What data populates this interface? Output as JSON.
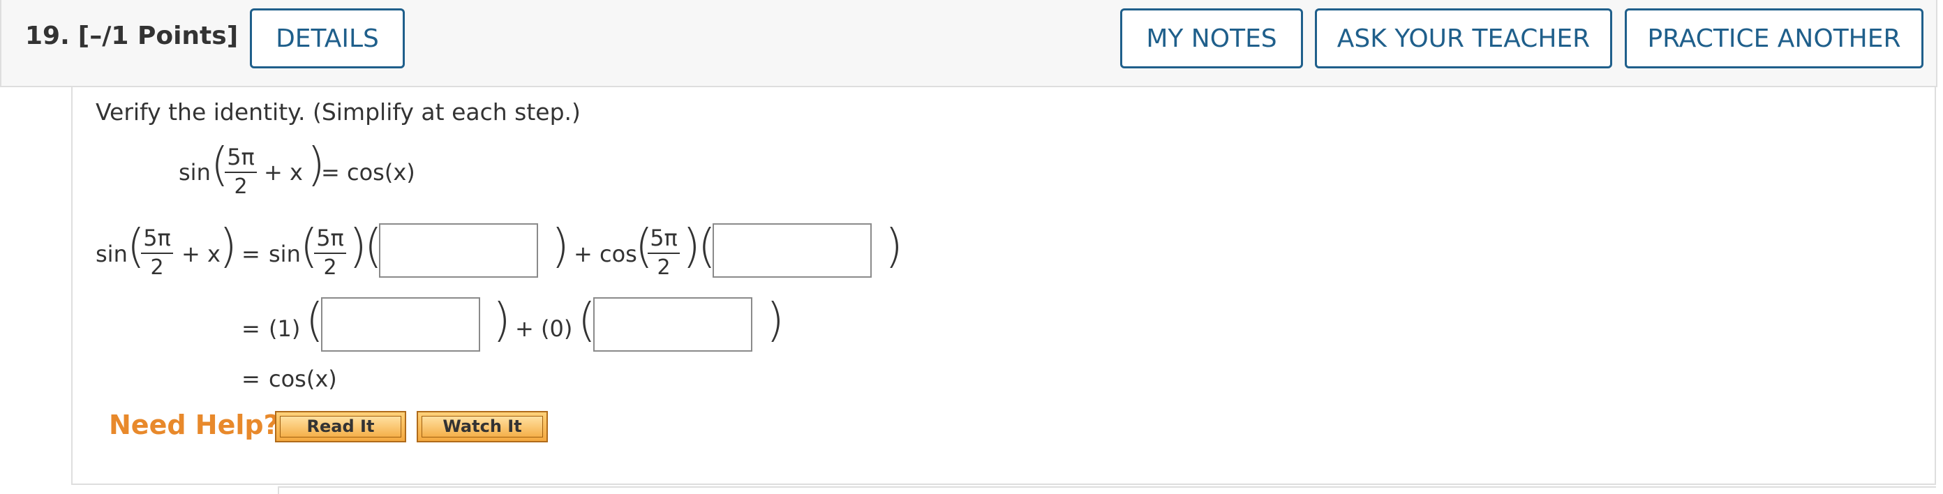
{
  "header": {
    "question_number": "19.",
    "points": "[–/1 Points]",
    "details_label": "DETAILS",
    "my_notes_label": "MY NOTES",
    "ask_teacher_label": "ASK YOUR TEACHER",
    "practice_another_label": "PRACTICE ANOTHER"
  },
  "problem": {
    "prompt": "Verify the identity. (Simplify at each step.)",
    "identity": {
      "sin": "sin",
      "numerator": "5π",
      "denominator": "2",
      "plus_x": "+ x",
      "rhs": "= cos(x)"
    }
  },
  "steps": {
    "line1": {
      "lhs_sin": "sin",
      "lhs_num": "5π",
      "lhs_den": "2",
      "lhs_plus": "+ x",
      "eq": "=",
      "sin": "sin",
      "num1": "5π",
      "den1": "2",
      "plus_cos": "+ cos",
      "num2": "5π",
      "den2": "2"
    },
    "line2": {
      "eq": "=",
      "coef1": "(1)",
      "plus_coef2": "+ (0)"
    },
    "line3": {
      "eq": "=",
      "result": "cos(x)"
    },
    "answers": [
      "",
      "",
      "",
      ""
    ]
  },
  "help": {
    "label": "Need Help?",
    "read_it": "Read It",
    "watch_it": "Watch It"
  },
  "colors": {
    "button_border": "#1f5f8b",
    "need_help": "#e8892b",
    "help_button": "#f4a940"
  }
}
